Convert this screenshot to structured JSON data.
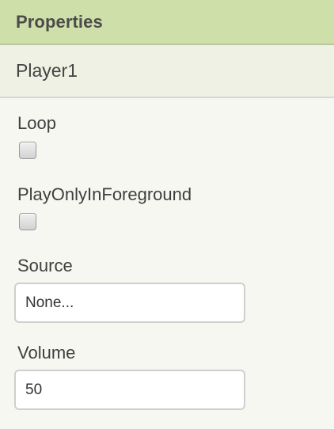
{
  "header": {
    "title": "Properties"
  },
  "component": {
    "name": "Player1"
  },
  "properties": {
    "loop": {
      "label": "Loop",
      "checked": false
    },
    "play_only_in_foreground": {
      "label": "PlayOnlyInForeground",
      "checked": false
    },
    "source": {
      "label": "Source",
      "value": "None..."
    },
    "volume": {
      "label": "Volume",
      "value": "50"
    }
  },
  "colors": {
    "header_bg": "#cfdfa9",
    "component_row_bg": "#eef1e3",
    "panel_bg": "#f6f7f1"
  }
}
